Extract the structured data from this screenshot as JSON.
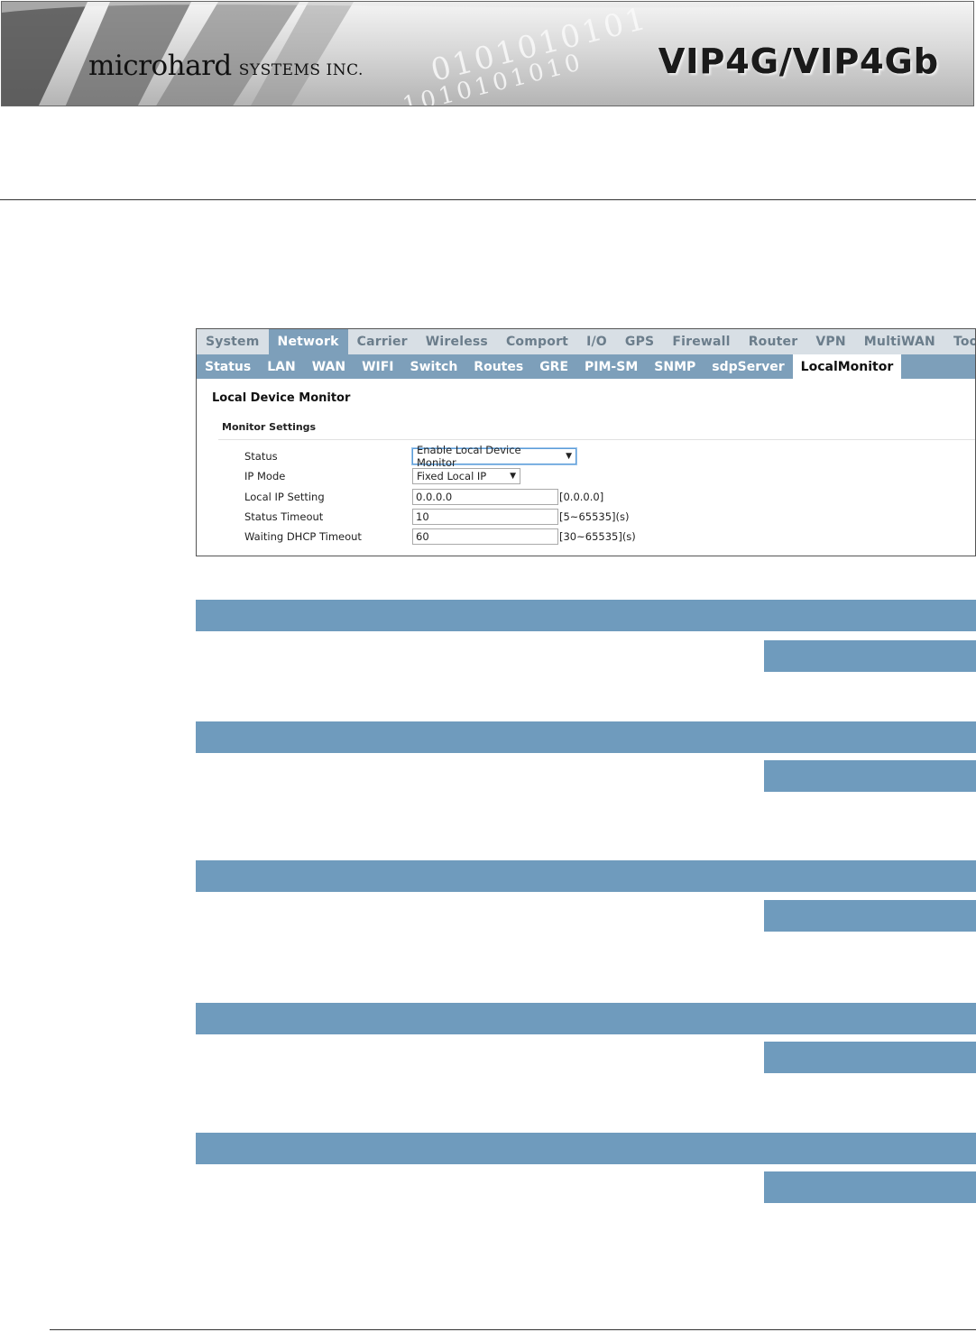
{
  "banner": {
    "company": "microhard",
    "company_suffix": "SYSTEMS INC.",
    "product": "VIP4G/VIP4Gb",
    "binary_decoration": [
      "0101010101",
      "1010101010"
    ]
  },
  "ui": {
    "top_menu": [
      "System",
      "Network",
      "Carrier",
      "Wireless",
      "Comport",
      "I/O",
      "GPS",
      "Firewall",
      "Router",
      "VPN",
      "MultiWAN",
      "Tools"
    ],
    "top_menu_active": "Network",
    "sub_menu": [
      "Status",
      "LAN",
      "WAN",
      "WIFI",
      "Switch",
      "Routes",
      "GRE",
      "PIM-SM",
      "SNMP",
      "sdpServer",
      "LocalMonitor"
    ],
    "sub_menu_active": "LocalMonitor",
    "page_title": "Local Device Monitor",
    "section_title": "Monitor Settings",
    "fields": {
      "status": {
        "label": "Status",
        "value": "Enable Local Device Monitor"
      },
      "ip_mode": {
        "label": "IP Mode",
        "value": "Fixed Local IP"
      },
      "local_ip": {
        "label": "Local IP Setting",
        "value": "0.0.0.0",
        "hint": "[0.0.0.0]"
      },
      "status_timeout": {
        "label": "Status Timeout",
        "value": "10",
        "hint": "[5~65535](s)"
      },
      "dhcp_timeout": {
        "label": "Waiting DHCP Timeout",
        "value": "60",
        "hint": "[30~65535](s)"
      }
    }
  },
  "colors": {
    "bar": "#6f9bbd",
    "menu_bg": "#d8dfe5",
    "submenu_bg": "#7d9fba"
  }
}
